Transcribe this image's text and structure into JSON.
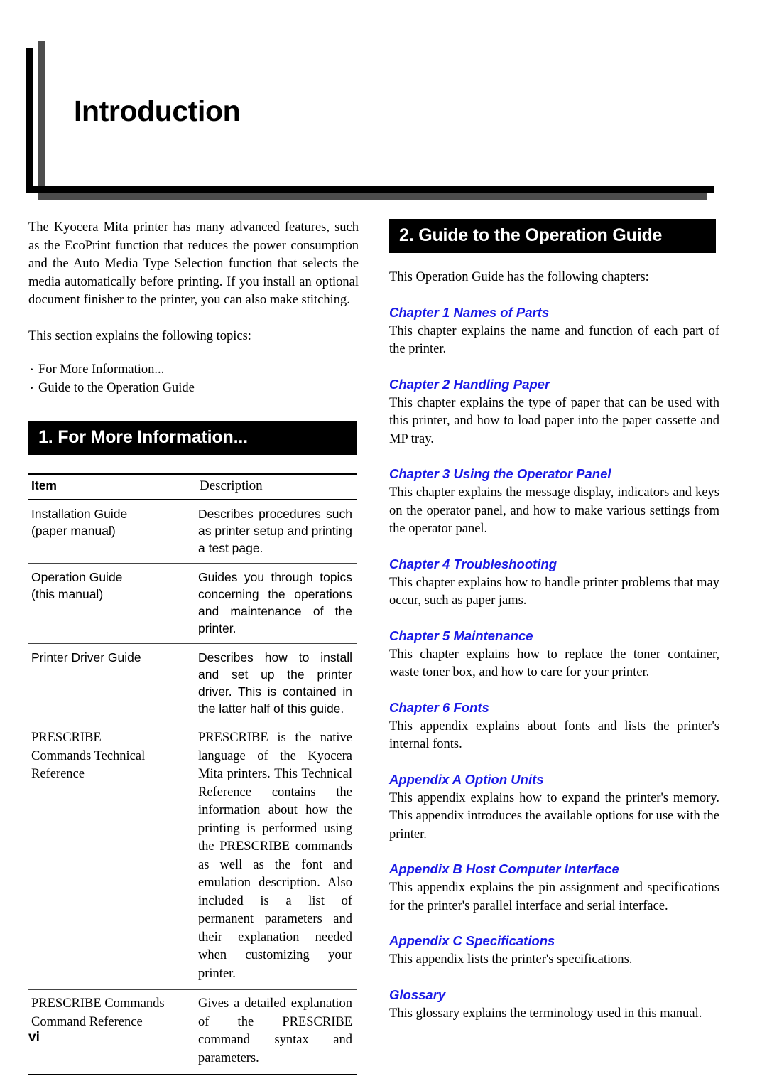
{
  "chapter": {
    "title": "Introduction"
  },
  "intro": {
    "paragraph1": "The Kyocera Mita printer has many advanced features, such as the EcoPrint function that reduces the power consumption and the Auto Media Type Selection function that selects the media automatically before printing. If you install an optional document finisher to the printer, you can also make stitching.",
    "paragraph2": "This section explains the following topics:",
    "topics": [
      "For More Information...",
      "Guide to the Operation Guide"
    ]
  },
  "section1": {
    "bar_label": "1. For More Information...",
    "table": {
      "headers": [
        "Item",
        "Description"
      ],
      "rows": [
        {
          "item": "Installation Guide\n(paper manual)",
          "description": "Describes procedures such as printer setup and printing a test page.",
          "font": "sans"
        },
        {
          "item": "Operation Guide\n(this manual)",
          "description": "Guides you through topics concerning the operations and maintenance of the printer.",
          "font": "sans"
        },
        {
          "item": "Printer Driver Guide",
          "description": "Describes how to install and set up the printer driver. This is contained in the latter half of this guide.",
          "font": "sans"
        },
        {
          "item": "PRESCRIBE\nCommands Technical\nReference",
          "description": "PRESCRIBE is the native language of the Kyocera Mita printers. This Technical Reference contains the information about how the printing is performed using the PRESCRIBE commands as well as the font and emulation description. Also included is a list of permanent parameters and their explanation needed when customizing your printer.",
          "font": "serif"
        },
        {
          "item": "PRESCRIBE Commands\nCommand Reference",
          "description": "Gives a detailed explanation of the PRESCRIBE command syntax and parameters.",
          "font": "serif"
        }
      ]
    }
  },
  "section2": {
    "bar_label": "2. Guide to the Operation Guide",
    "lead": "This Operation Guide has the following chapters:",
    "entries": [
      {
        "heading": "Chapter 1 Names of Parts",
        "description": "This chapter explains the name and function of each part of the printer."
      },
      {
        "heading": "Chapter 2 Handling Paper",
        "description": "This chapter explains the type of paper that can be used with this printer, and how to load paper into the paper cassette and MP tray."
      },
      {
        "heading": "Chapter 3 Using the Operator Panel",
        "description": "This chapter explains the message display, indicators and keys on the operator panel, and how to make various settings from the operator panel."
      },
      {
        "heading": "Chapter 4 Troubleshooting",
        "description": "This chapter explains how to handle printer problems that may occur, such as paper jams."
      },
      {
        "heading": "Chapter 5 Maintenance",
        "description": "This chapter explains how to replace the toner container, waste toner box, and how to care for your printer."
      },
      {
        "heading": "Chapter 6 Fonts",
        "description": "This appendix explains about fonts and lists the printer's internal fonts."
      },
      {
        "heading": "Appendix A Option Units",
        "description": "This appendix explains how to expand the printer's memory. This appendix introduces the available options for use with the printer."
      },
      {
        "heading": "Appendix B Host Computer Interface",
        "description": "This appendix explains the pin assignment and specifications for the printer's parallel interface and serial interface."
      },
      {
        "heading": "Appendix C Specifications",
        "description": "This appendix lists the printer's specifications."
      },
      {
        "heading": "Glossary",
        "description": "This glossary explains the terminology used in this manual."
      }
    ]
  },
  "footer": {
    "page_number": "vi"
  },
  "colors": {
    "accent_blue": "#1a1ae6",
    "bar_black": "#000000",
    "deco_gray": "#4d4d4d"
  }
}
